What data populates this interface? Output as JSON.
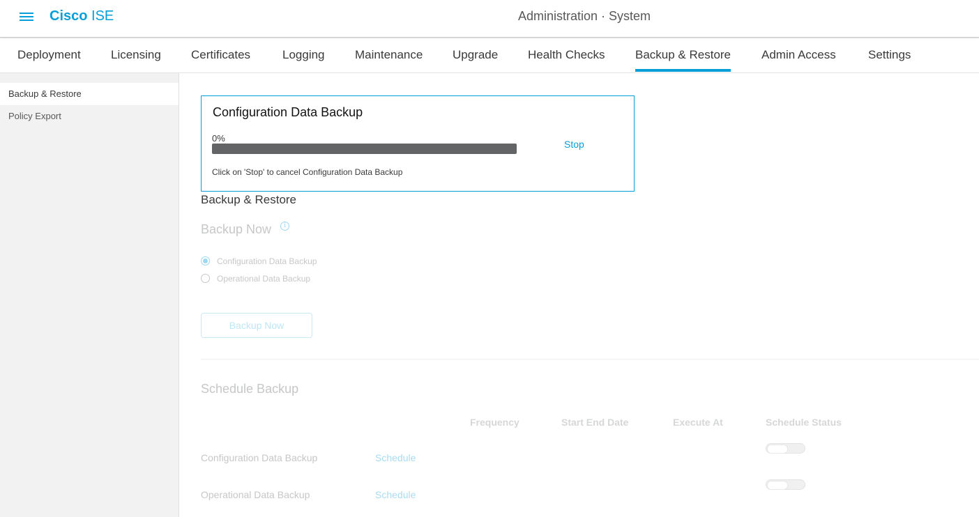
{
  "header": {
    "brand_bold": "Cisco",
    "brand_light": "ISE",
    "title": "Administration · System"
  },
  "tabs": [
    {
      "label": "Deployment"
    },
    {
      "label": "Licensing"
    },
    {
      "label": "Certificates"
    },
    {
      "label": "Logging"
    },
    {
      "label": "Maintenance"
    },
    {
      "label": "Upgrade"
    },
    {
      "label": "Health Checks"
    },
    {
      "label": "Backup & Restore",
      "active": true
    },
    {
      "label": "Admin Access"
    },
    {
      "label": "Settings"
    }
  ],
  "sidebar": {
    "items": [
      {
        "label": "Backup & Restore",
        "active": true
      },
      {
        "label": "Policy Export"
      }
    ]
  },
  "progress": {
    "title": "Configuration Data Backup",
    "percent_text": "0%",
    "percent_value": 0,
    "stop_label": "Stop",
    "message": "Click on 'Stop' to cancel Configuration Data Backup"
  },
  "main": {
    "section_title": "Backup & Restore",
    "backup_now_title": "Backup Now",
    "radios": [
      {
        "label": "Configuration Data Backup",
        "checked": true
      },
      {
        "label": "Operational Data Backup",
        "checked": false
      }
    ],
    "backup_button": "Backup Now",
    "schedule_title": "Schedule Backup",
    "columns": [
      "Frequency",
      "Start End Date",
      "Execute At",
      "Schedule Status"
    ],
    "rows": [
      {
        "label": "Configuration Data Backup",
        "link": "Schedule",
        "enabled": false
      },
      {
        "label": "Operational Data Backup",
        "link": "Schedule",
        "enabled": false
      }
    ]
  },
  "colors": {
    "accent": "#049fd9",
    "progress_bar": "#636466",
    "muted_text": "#c6c7c8"
  },
  "icons": {
    "menu": "hamburger-menu-icon",
    "info": "info-icon"
  }
}
